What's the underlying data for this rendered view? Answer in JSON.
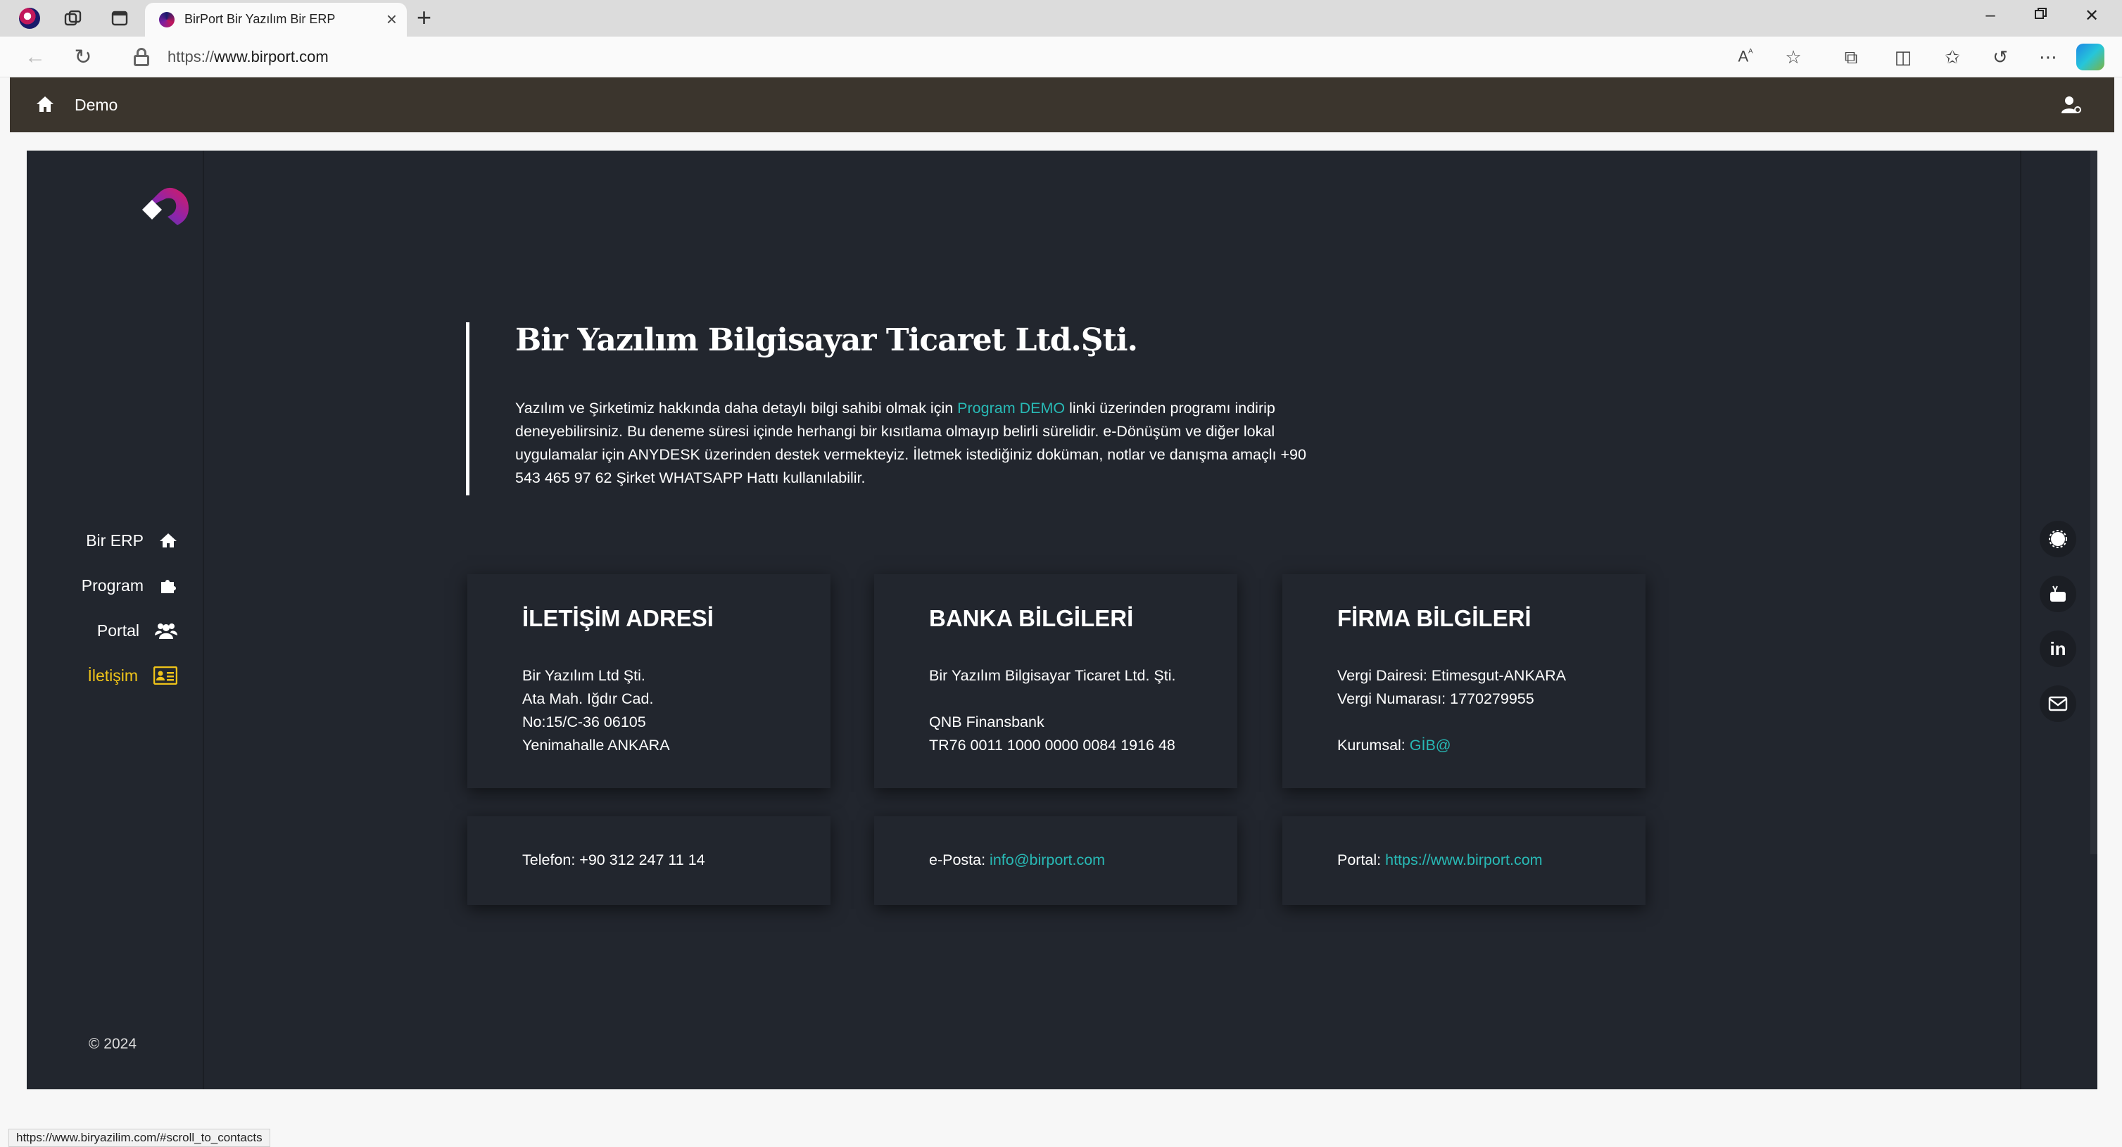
{
  "browser": {
    "tab_title": "BirPort Bir Yazılım Bir ERP",
    "url_prefix": "https://",
    "url_host": "www.birport.com",
    "status_url": "https://www.biryazilim.com/#scroll_to_contacts"
  },
  "topbar": {
    "demo_label": "Demo"
  },
  "sidebar": {
    "items": [
      {
        "label": "Bir ERP",
        "icon": "home-icon"
      },
      {
        "label": "Program",
        "icon": "puzzle-icon"
      },
      {
        "label": "Portal",
        "icon": "users-icon"
      },
      {
        "label": "İletişim",
        "icon": "contact-card-icon",
        "active": true
      }
    ],
    "copyright": "© 2024"
  },
  "social": [
    "circle-icon",
    "youtube-icon",
    "linkedin-icon",
    "mail-icon"
  ],
  "intro": {
    "title": "Bir Yazılım Bilgisayar Ticaret Ltd.Şti.",
    "text_before": "Yazılım ve Şirketimiz hakkında daha detaylı bilgi sahibi olmak için ",
    "link": "Program DEMO",
    "text_after": " linki üzerinden programı indirip deneyebilirsiniz. Bu deneme süresi içinde herhangi bir kısıtlama olmayıp belirli sürelidir. e-Dönüşüm ve diğer lokal uygulamalar için ANYDESK üzerinden destek vermekteyiz. İletmek istediğiniz doküman, notlar ve danışma amaçlı +90 543 465 97 62 Şirket WHATSAPP Hattı kullanılabilir."
  },
  "cards": {
    "address": {
      "title": "İLETİŞİM ADRESİ",
      "lines": [
        "Bir Yazılım Ltd Şti.",
        "Ata Mah. Iğdır Cad.",
        "No:15/C-36 06105",
        "Yenimahalle ANKARA"
      ]
    },
    "bank": {
      "title": "BANKA BİLGİLERİ",
      "line1": "Bir Yazılım Bilgisayar Ticaret Ltd. Şti.",
      "line2": "QNB Finansbank",
      "line3": "TR76 0011 1000 0000 0084 1916 48"
    },
    "company": {
      "title": "FİRMA BİLGİLERİ",
      "line1": "Vergi Dairesi: Etimesgut-ANKARA",
      "line2": "Vergi Numarası: 1770279955",
      "kurumsal_label": "Kurumsal: ",
      "kurumsal_link": "GİB@"
    }
  },
  "contact": {
    "phone": "Telefon: +90 312 247 11 14",
    "email_label": "e-Posta: ",
    "email": "info@birport.com",
    "portal_label": "Portal: ",
    "portal": "https://www.birport.com"
  }
}
